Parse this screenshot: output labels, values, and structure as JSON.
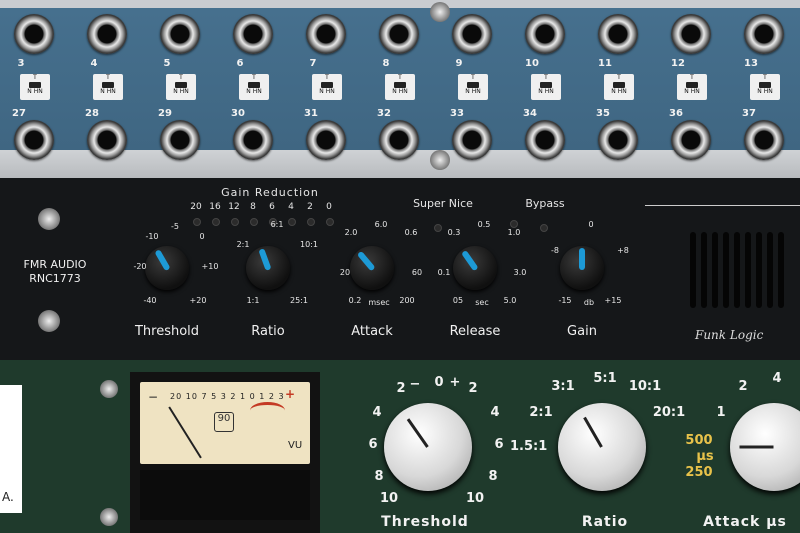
{
  "patchbay": {
    "channels": [
      {
        "top": "3",
        "bottom": "27"
      },
      {
        "top": "4",
        "bottom": "28"
      },
      {
        "top": "5",
        "bottom": "29"
      },
      {
        "top": "6",
        "bottom": "30"
      },
      {
        "top": "7",
        "bottom": "31"
      },
      {
        "top": "8",
        "bottom": "32"
      },
      {
        "top": "9",
        "bottom": "33"
      },
      {
        "top": "10",
        "bottom": "34"
      },
      {
        "top": "11",
        "bottom": "35"
      },
      {
        "top": "12",
        "bottom": "36"
      },
      {
        "top": "13",
        "bottom": "37"
      }
    ],
    "switch_top": "T",
    "switch_bottom": "N HN"
  },
  "rnc": {
    "brand": "FMR AUDIO",
    "model": "RNC1773",
    "gain_reduction_title": "Gain Reduction",
    "gr_scale": [
      "20",
      "16",
      "12",
      "8",
      "6",
      "4",
      "2",
      "0"
    ],
    "super_nice": "Super Nice",
    "bypass": "Bypass",
    "maker": "Funk Logic",
    "knobs": [
      {
        "name": "Threshold",
        "scale": [
          "-10",
          "-5",
          "0",
          "-20",
          "+10",
          "-40",
          "+20"
        ]
      },
      {
        "name": "Ratio",
        "scale": [
          "6:1",
          "2:1",
          "10:1",
          "1:1",
          "25:1"
        ]
      },
      {
        "name": "Attack",
        "scale": [
          "2.0",
          "6.0",
          "0.6",
          "20",
          "60",
          "0.2",
          "msec",
          "200"
        ]
      },
      {
        "name": "Release",
        "scale": [
          "0.3",
          "0.5",
          "1.0",
          "0.1",
          "3.0",
          "05",
          "sec",
          "5.0"
        ]
      },
      {
        "name": "Gain",
        "scale": [
          "0",
          "-8",
          "+8",
          "-15",
          "db",
          "+15"
        ]
      }
    ]
  },
  "comp": {
    "vu": {
      "scale": "20 10 7 5 3 2 1 0 1 2 3",
      "plus": "+",
      "minus": "−",
      "unit": "VU",
      "logo": "90"
    },
    "threshold": {
      "label": "Threshold",
      "scale": [
        "2",
        "−",
        "0",
        "+",
        "2",
        "4",
        "4",
        "6",
        "6",
        "8",
        "8",
        "10",
        "10"
      ]
    },
    "ratio": {
      "label": "Ratio",
      "scale": [
        "3:1",
        "5:1",
        "10:1",
        "2:1",
        "20:1",
        "1.5:1"
      ]
    },
    "attack": {
      "label": "Attack μs",
      "scale": [
        "2",
        "4",
        "1",
        "500",
        "μs",
        "250"
      ]
    },
    "side_text": "A."
  }
}
